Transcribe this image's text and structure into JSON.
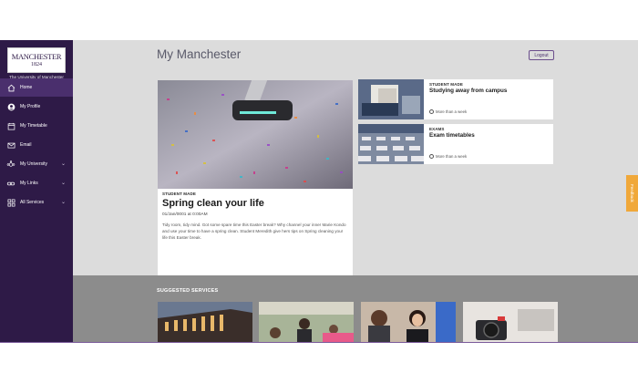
{
  "sidebar": {
    "logo": {
      "line1": "MANCHESTER",
      "line2": "1824"
    },
    "university": "The University of Manchester",
    "items": [
      {
        "label": "Home",
        "icon": "home-icon",
        "active": true
      },
      {
        "label": "My Profile",
        "icon": "profile-icon"
      },
      {
        "label": "My Timetable",
        "icon": "calendar-icon"
      },
      {
        "label": "Email",
        "icon": "email-icon"
      },
      {
        "label": "My University",
        "icon": "university-icon",
        "expandable": true
      },
      {
        "label": "My Links",
        "icon": "link-icon",
        "expandable": true
      },
      {
        "label": "All Services",
        "icon": "services-icon",
        "expandable": true
      }
    ]
  },
  "header": {
    "title": "My Manchester",
    "logout": "Logout"
  },
  "feature": {
    "category": "STUDENT MADE",
    "title": "Spring clean your life",
    "date": "01/Jan/0001 at 0:00AM",
    "body": "Tidy room, tidy mind. Got some spare time this Easter break? Why channel your inner Marie Kondo and use your time to have a spring clean. Student Meredith give hers tips on Spring cleaning your life this Easter break.",
    "time": "More than a week"
  },
  "cards": [
    {
      "category": "STUDENT MADE",
      "title": "Studying away from campus",
      "time": "More than a week"
    },
    {
      "category": "EXAMS",
      "title": "Exam timetables",
      "time": "More than a week"
    }
  ],
  "feedback": "Feedback",
  "services": {
    "label": "SUGGESTED SERVICES"
  },
  "colors": {
    "sidebar": "#2e1a47",
    "active": "#4a2f6d",
    "content_bg": "#dcdcdc",
    "accent": "#f0a83a"
  }
}
